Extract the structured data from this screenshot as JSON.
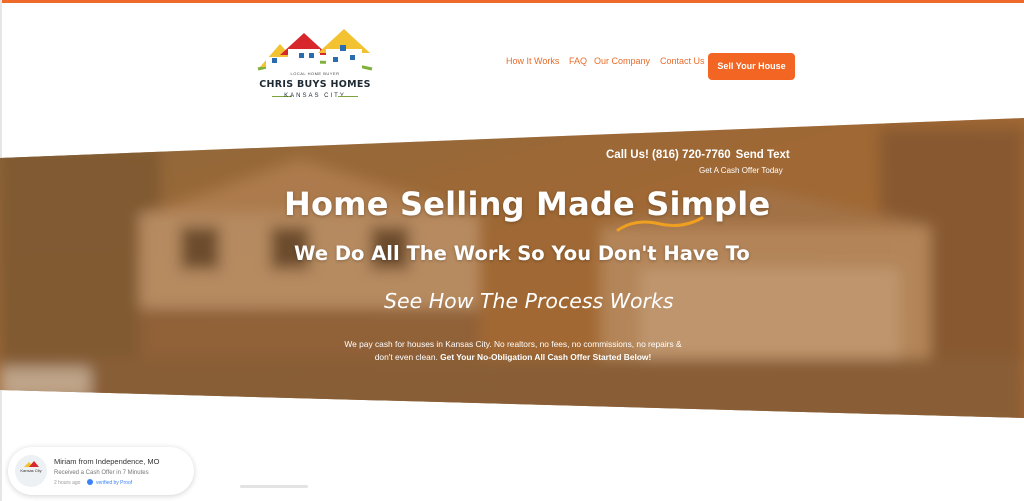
{
  "brand": {
    "tagline": "LOCAL HOME BUYER",
    "name": "CHRIS BUYS HOMES",
    "city": "KANSAS CITY"
  },
  "nav": {
    "items": [
      "How It Works",
      "FAQ",
      "Our Company",
      "Contact Us"
    ],
    "cta": "Sell Your House"
  },
  "hero": {
    "call": "Call Us! (816) 720-7760",
    "send_text": "Send Text",
    "cash_offer": "Get A Cash Offer Today",
    "headline": "Home Selling Made Simple",
    "subhead": "We Do All The Work So You Don't Have To",
    "process_link": "See How The Process Works",
    "desc_line1": "We pay cash for houses in Kansas City. No realtors, no fees, no commissions, no repairs &",
    "desc_line2_plain": "don't even clean.",
    "desc_line2_bold": "Get Your No-Obligation All Cash Offer Started Below!"
  },
  "notification": {
    "avatar_text": "Kansas City",
    "name": "Miriam from Independence, MO",
    "message": "Received a Cash Offer in 7 Minutes",
    "time": "2 hours ago",
    "verified": "verified by Proof"
  },
  "colors": {
    "accent": "#f26522",
    "nav_text": "#e86b2a",
    "headline_underline": "#f0a020"
  }
}
